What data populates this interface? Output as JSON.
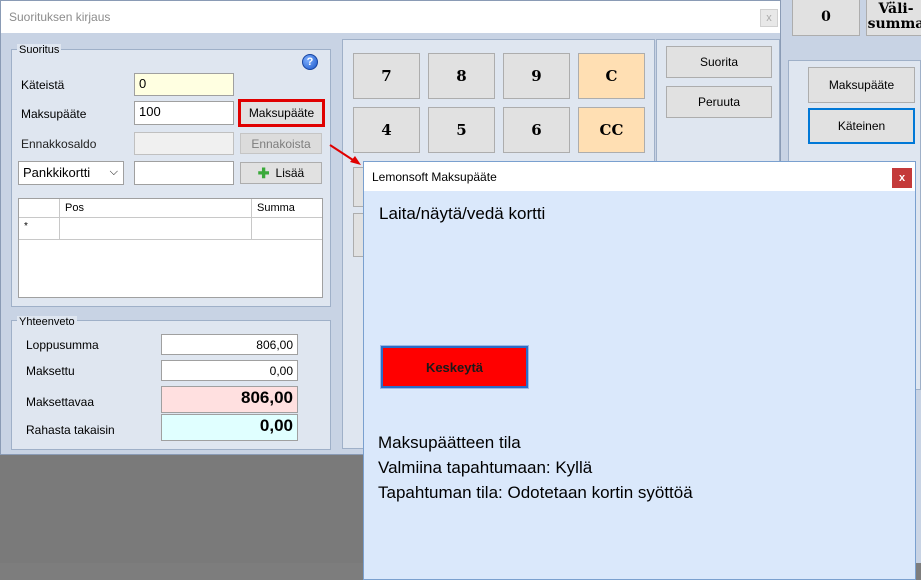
{
  "background_app": {
    "numbtn_zero": "0",
    "numbtn_valisumma": "Väli-\nsumma",
    "side_buttons": [
      "Maksupääte",
      "Käteinen"
    ]
  },
  "main_window": {
    "title": "Suorituksen kirjaus",
    "close_glyph": "x",
    "suoritus": {
      "caption": "Suoritus",
      "help_glyph": "?",
      "kateista_label": "Käteistä",
      "kateista_value": "0",
      "maksupaate_label": "Maksupääte",
      "maksupaate_value": "100",
      "maksupaate_button": "Maksupääte",
      "ennakkosaldo_label": "Ennakkosaldo",
      "ennakkosaldo_value": "",
      "ennakoista_button": "Ennakoista",
      "payment_type_selected": "Pankkikortti",
      "payment_amount_value": "",
      "lisaa_button": "Lisää",
      "grid": {
        "columns": [
          "Pos",
          "Summa"
        ],
        "new_row_marker": "*"
      }
    },
    "yhteenveto": {
      "caption": "Yhteenveto",
      "loppusumma_label": "Loppusumma",
      "loppusumma_value": "806,00",
      "maksettu_label": "Maksettu",
      "maksettu_value": "0,00",
      "maksettavaa_label": "Maksettavaa",
      "maksettavaa_value": "806,00",
      "rahasta_label": "Rahasta takaisin",
      "rahasta_value": "0,00"
    },
    "keypad": {
      "keys_row1": [
        "7",
        "8",
        "9",
        "C"
      ],
      "keys_row2": [
        "4",
        "5",
        "6",
        "CC"
      ]
    },
    "actions": {
      "suorita": "Suorita",
      "peruuta": "Peruuta"
    }
  },
  "terminal_popup": {
    "title": "Lemonsoft Maksupääte",
    "close_glyph": "x",
    "message": "Laita/näytä/vedä kortti",
    "cancel_button": "Keskeytä",
    "status_heading": "Maksupäätteen tila",
    "ready_line": "Valmiina tapahtumaan: Kyllä",
    "state_line": "Tapahtuman tila: Odotetaan kortin syöttöä"
  },
  "colors": {
    "highlight_red": "#e00000",
    "cancel_red": "#ff0000",
    "orange_key": "#ffdfb3",
    "pink_field": "#ffe0e0",
    "cyan_field": "#e0ffff"
  }
}
